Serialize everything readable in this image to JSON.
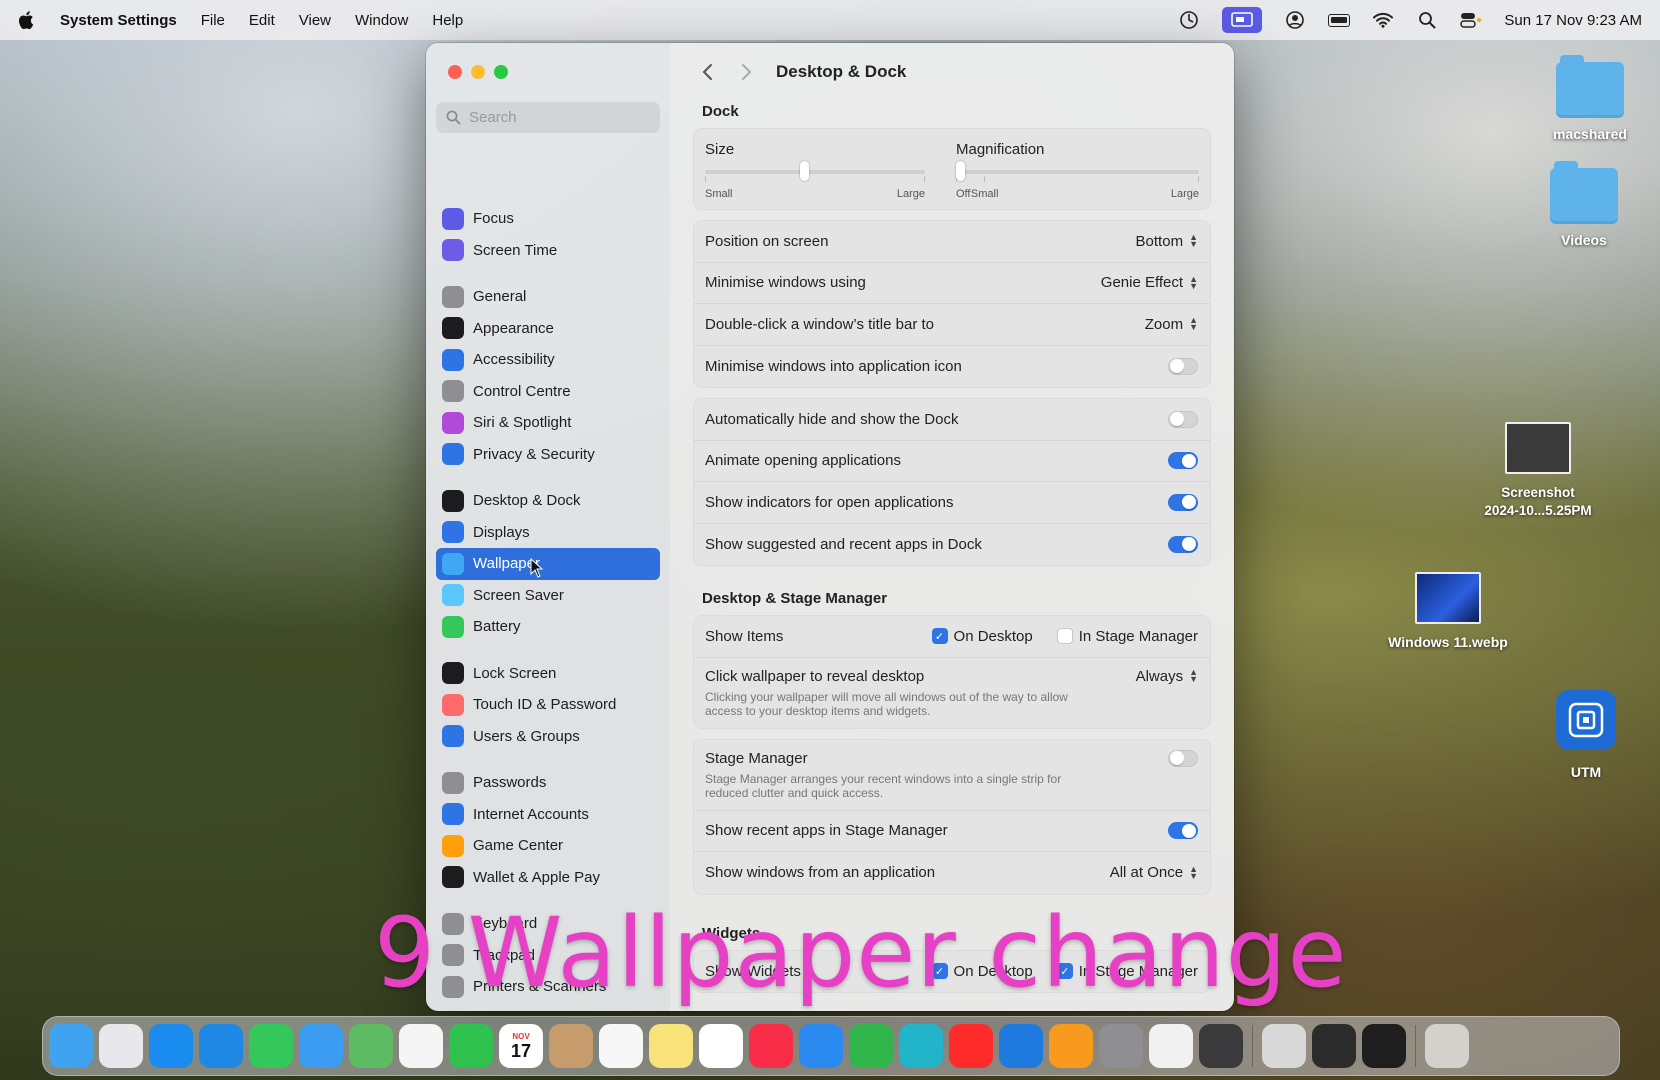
{
  "menubar": {
    "apple": "apple-icon",
    "app_name": "System Settings",
    "menus": [
      "File",
      "Edit",
      "View",
      "Window",
      "Help"
    ],
    "datetime": "Sun 17 Nov  9:23 AM"
  },
  "sidebar": {
    "search_placeholder": "Search",
    "groups": [
      [
        {
          "label": "Focus",
          "icon": "moon-icon",
          "color": "#5e5ce6"
        },
        {
          "label": "Screen Time",
          "icon": "hourglass-icon",
          "color": "#6e5be6"
        }
      ],
      [
        {
          "label": "General",
          "icon": "gear-icon",
          "color": "#8e8e93"
        },
        {
          "label": "Appearance",
          "icon": "appearance-icon",
          "color": "#1c1c1e"
        },
        {
          "label": "Accessibility",
          "icon": "accessibility-icon",
          "color": "#2f74e4"
        },
        {
          "label": "Control Centre",
          "icon": "control-centre-icon",
          "color": "#8e8e93"
        },
        {
          "label": "Siri & Spotlight",
          "icon": "siri-icon",
          "color": "#b04ad8"
        },
        {
          "label": "Privacy & Security",
          "icon": "hand-icon",
          "color": "#2f74e4"
        }
      ],
      [
        {
          "label": "Desktop & Dock",
          "icon": "dock-icon",
          "color": "#1c1c1e"
        },
        {
          "label": "Displays",
          "icon": "sun-icon",
          "color": "#2f74e4"
        },
        {
          "label": "Wallpaper",
          "icon": "wallpaper-icon",
          "color": "#3fa8f5",
          "selected": true
        },
        {
          "label": "Screen Saver",
          "icon": "screen-saver-icon",
          "color": "#5ac8fa"
        },
        {
          "label": "Battery",
          "icon": "battery-icon",
          "color": "#34c759"
        }
      ],
      [
        {
          "label": "Lock Screen",
          "icon": "lock-icon",
          "color": "#1c1c1e"
        },
        {
          "label": "Touch ID & Password",
          "icon": "fingerprint-icon",
          "color": "#ff6b6b"
        },
        {
          "label": "Users & Groups",
          "icon": "users-icon",
          "color": "#2f74e4"
        }
      ],
      [
        {
          "label": "Passwords",
          "icon": "key-icon",
          "color": "#8e8e93"
        },
        {
          "label": "Internet Accounts",
          "icon": "at-icon",
          "color": "#2f74e4"
        },
        {
          "label": "Game Center",
          "icon": "game-center-icon",
          "color": "#ff9f0a"
        },
        {
          "label": "Wallet & Apple Pay",
          "icon": "wallet-icon",
          "color": "#1c1c1e"
        }
      ],
      [
        {
          "label": "Keyboard",
          "icon": "keyboard-icon",
          "color": "#8e8e93"
        },
        {
          "label": "Trackpad",
          "icon": "trackpad-icon",
          "color": "#8e8e93"
        },
        {
          "label": "Printers & Scanners",
          "icon": "printer-icon",
          "color": "#8e8e93"
        }
      ]
    ]
  },
  "content": {
    "title": "Desktop & Dock",
    "dock_section": "Dock",
    "size_label": "Size",
    "size_small": "Small",
    "size_large": "Large",
    "size_value": 0.43,
    "magnification_label": "Magnification",
    "mag_off": "Off",
    "mag_small": "Small",
    "mag_large": "Large",
    "mag_value": 0,
    "rows1": [
      {
        "label": "Position on screen",
        "value": "Bottom"
      },
      {
        "label": "Minimise windows using",
        "value": "Genie Effect"
      },
      {
        "label": "Double-click a window’s title bar to",
        "value": "Zoom"
      }
    ],
    "minimise_into_icon": {
      "label": "Minimise windows into application icon",
      "on": false
    },
    "toggles2": [
      {
        "label": "Automatically hide and show the Dock",
        "on": false
      },
      {
        "label": "Animate opening applications",
        "on": true
      },
      {
        "label": "Show indicators for open applications",
        "on": true
      },
      {
        "label": "Show suggested and recent apps in Dock",
        "on": true
      }
    ],
    "stage_section": "Desktop & Stage Manager",
    "show_items_label": "Show Items",
    "on_desktop": "On Desktop",
    "in_stage_manager": "In Stage Manager",
    "click_wallpaper_label": "Click wallpaper to reveal desktop",
    "click_wallpaper_sub": "Clicking your wallpaper will move all windows out of the way to allow access to your desktop items and widgets.",
    "click_wallpaper_value": "Always",
    "stage_manager_label": "Stage Manager",
    "stage_manager_sub": "Stage Manager arranges your recent windows into a single strip for reduced clutter and quick access.",
    "show_recent_label": "Show recent apps in Stage Manager",
    "show_windows_label": "Show windows from an application",
    "show_windows_value": "All at Once",
    "widgets_section": "Widgets",
    "show_widgets_label": "Show Widgets"
  },
  "desktop": {
    "items": [
      "macshared",
      "Videos",
      "Screenshot\n2024-10...5.25PM",
      "Windows 11.webp",
      "UTM"
    ]
  },
  "caption": "9 Wallpaper change",
  "dock": {
    "calendar_month": "NOV",
    "calendar_day": "17",
    "apps": [
      {
        "name": "finder",
        "color": "#3fa3f0"
      },
      {
        "name": "launchpad",
        "color": "#e8e8ec"
      },
      {
        "name": "app-store",
        "color": "#1a8cf0"
      },
      {
        "name": "safari",
        "color": "#1e88e5"
      },
      {
        "name": "messages",
        "color": "#34c759"
      },
      {
        "name": "mail",
        "color": "#3b9cf2"
      },
      {
        "name": "maps",
        "color": "#5dbb63"
      },
      {
        "name": "photos",
        "color": "#f5f5f5"
      },
      {
        "name": "facetime",
        "color": "#30c24f"
      },
      {
        "name": "calendar",
        "color": "#ffffff"
      },
      {
        "name": "contacts",
        "color": "#c69c6d"
      },
      {
        "name": "reminders",
        "color": "#f7f7f7"
      },
      {
        "name": "notes",
        "color": "#f8e27a"
      },
      {
        "name": "freeform",
        "color": "#ffffff"
      },
      {
        "name": "music",
        "color": "#fa2d48"
      },
      {
        "name": "keynote",
        "color": "#2b8af0"
      },
      {
        "name": "numbers",
        "color": "#2fb54a"
      },
      {
        "name": "canva",
        "color": "#22b4c8"
      },
      {
        "name": "youtube",
        "color": "#ff2a2a"
      },
      {
        "name": "windows-app",
        "color": "#1f7ae0"
      },
      {
        "name": "pages",
        "color": "#f79a1e"
      },
      {
        "name": "system-settings",
        "color": "#8e8e93"
      },
      {
        "name": "chrome",
        "color": "#f1f1f1"
      },
      {
        "name": "quicktime",
        "color": "#3a3a3c"
      }
    ],
    "apps_right": [
      {
        "name": "preview",
        "color": "#d8d8d8"
      },
      {
        "name": "davinci-resolve",
        "color": "#2b2b2b"
      },
      {
        "name": "obs",
        "color": "#1e1e1e"
      }
    ],
    "trash": "trash-icon"
  }
}
